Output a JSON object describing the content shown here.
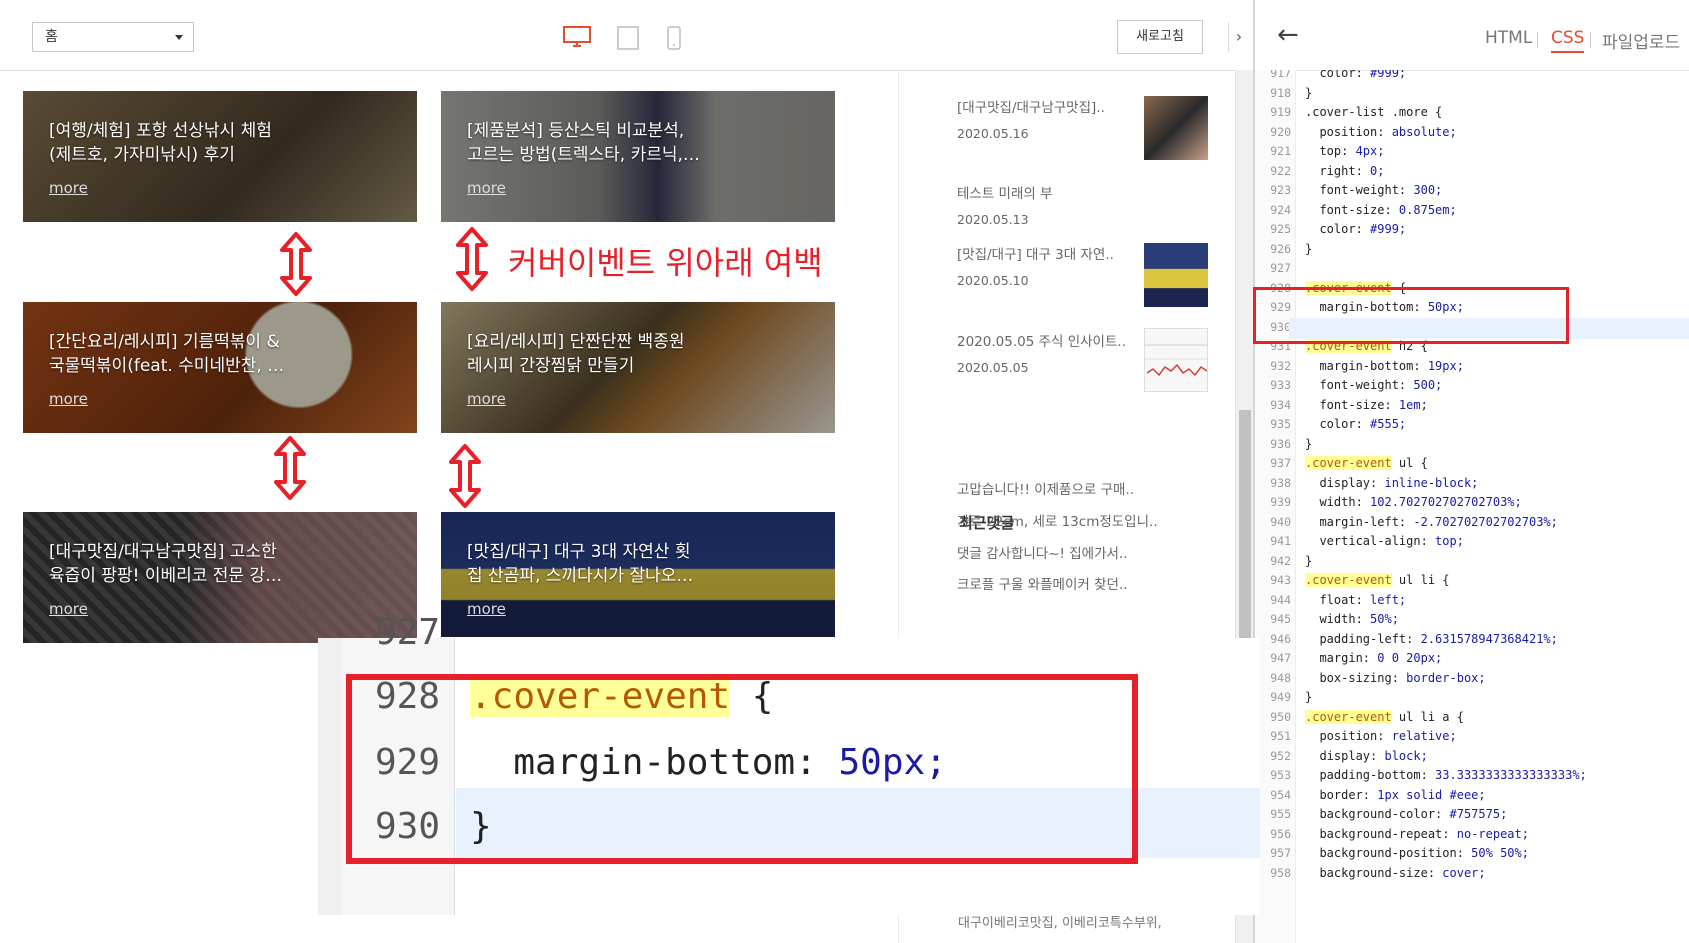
{
  "toolbar": {
    "page_select": "홈",
    "refresh_label": "새로고침",
    "collapse_icon": "›"
  },
  "cards": [
    {
      "title1": "[여행/체험] 포항 선상낚시 체험",
      "title2": "(제트호, 가자미낚시) 후기",
      "more": "more",
      "color": "#6b5a42"
    },
    {
      "title1": "[제품분석] 등산스틱 비교분석,",
      "title2": "고르는 방법(트렉스타, 카르닉,…",
      "more": "more",
      "color": "#8a8a86"
    },
    {
      "title1": "[간단요리/레시피] 기름떡볶이 &",
      "title2": "국물떡볶이(feat. 수미네반찬, …",
      "more": "more",
      "color": "#8a5a2a"
    },
    {
      "title1": "[요리/레시피] 단짠단짠 백종원",
      "title2": "레시피 간장찜닭 만들기",
      "more": "more",
      "color": "#6e6a4a"
    },
    {
      "title1": "[대구맛집/대구남구맛집] 고소한",
      "title2": "육즙이 팡팡! 이베리코 전문 강…",
      "more": "more",
      "color": "#5a4a48"
    },
    {
      "title1": "[맛집/대구] 대구 3대 자연산 횟",
      "title2": "집 산곰파, 스끼다시가 잘나오…",
      "more": "more",
      "color": "#2f3d6e"
    }
  ],
  "annotation": "커버이벤트 위아래 여백",
  "sidebar": {
    "posts": [
      {
        "title": "[대구맛집/대구남구맛집]..",
        "date": "2020.05.16"
      },
      {
        "title": "테스트 미래의 부",
        "date": "2020.05.13"
      },
      {
        "title": "[맛집/대구] 대구 3대 자연..",
        "date": "2020.05.10"
      },
      {
        "title": "2020.05.05 주식 인사이트..",
        "date": "2020.05.05"
      }
    ],
    "recent_heading": "최근댓글",
    "comments": [
      "고맙습니다!! 이제품으로 구매..",
      "가로 22cm, 세로 13cm정도입니..",
      "댓글 감사합니다~! 집에가서..",
      "크로플 구울 와플메이커 찾던.."
    ],
    "tail_text": "대구이베리코맛집, 이베리코특수부위,"
  },
  "editor": {
    "back_icon": "←",
    "tabs": [
      "HTML",
      "CSS",
      "파일업로드"
    ],
    "active_tab": "CSS"
  },
  "code_lines": [
    {
      "n": "917",
      "t": "  color: #999;"
    },
    {
      "n": "918",
      "t": "}"
    },
    {
      "n": "919",
      "t": ".cover-list .more {"
    },
    {
      "n": "920",
      "t": "  position: absolute;"
    },
    {
      "n": "921",
      "t": "  top: 4px;"
    },
    {
      "n": "922",
      "t": "  right: 0;"
    },
    {
      "n": "923",
      "t": "  font-weight: 300;"
    },
    {
      "n": "924",
      "t": "  font-size: 0.875em;"
    },
    {
      "n": "925",
      "t": "  color: #999;"
    },
    {
      "n": "926",
      "t": "}"
    },
    {
      "n": "927",
      "t": ""
    },
    {
      "n": "928",
      "t": ".cover-event {"
    },
    {
      "n": "929",
      "t": "  margin-bottom: 50px;"
    },
    {
      "n": "930",
      "t": "}"
    },
    {
      "n": "931",
      "t": ".cover-event h2 {"
    },
    {
      "n": "932",
      "t": "  margin-bottom: 19px;"
    },
    {
      "n": "933",
      "t": "  font-weight: 500;"
    },
    {
      "n": "934",
      "t": "  font-size: 1em;"
    },
    {
      "n": "935",
      "t": "  color: #555;"
    },
    {
      "n": "936",
      "t": "}"
    },
    {
      "n": "937",
      "t": ".cover-event ul {"
    },
    {
      "n": "938",
      "t": "  display: inline-block;"
    },
    {
      "n": "939",
      "t": "  width: 102.702702702702703%;"
    },
    {
      "n": "940",
      "t": "  margin-left: -2.702702702702703%;"
    },
    {
      "n": "941",
      "t": "  vertical-align: top;"
    },
    {
      "n": "942",
      "t": "}"
    },
    {
      "n": "943",
      "t": ".cover-event ul li {"
    },
    {
      "n": "944",
      "t": "  float: left;"
    },
    {
      "n": "945",
      "t": "  width: 50%;"
    },
    {
      "n": "946",
      "t": "  padding-left: 2.631578947368421%;"
    },
    {
      "n": "947",
      "t": "  margin: 0 0 20px;"
    },
    {
      "n": "948",
      "t": "  box-sizing: border-box;"
    },
    {
      "n": "949",
      "t": "}"
    },
    {
      "n": "950",
      "t": ".cover-event ul li a {"
    },
    {
      "n": "951",
      "t": "  position: relative;"
    },
    {
      "n": "952",
      "t": "  display: block;"
    },
    {
      "n": "953",
      "t": "  padding-bottom: 33.3333333333333333%;"
    },
    {
      "n": "954",
      "t": "  border: 1px solid #eee;"
    },
    {
      "n": "955",
      "t": "  background-color: #757575;"
    },
    {
      "n": "956",
      "t": "  background-repeat: no-repeat;"
    },
    {
      "n": "957",
      "t": "  background-position: 50% 50%;"
    },
    {
      "n": "958",
      "t": "  background-size: cover;"
    }
  ],
  "zoom_lines": [
    {
      "n": "927",
      "t": ""
    },
    {
      "n": "928",
      "t": ".cover-event {"
    },
    {
      "n": "929",
      "t": "  margin-bottom: 50px;"
    },
    {
      "n": "930",
      "t": "}"
    }
  ]
}
